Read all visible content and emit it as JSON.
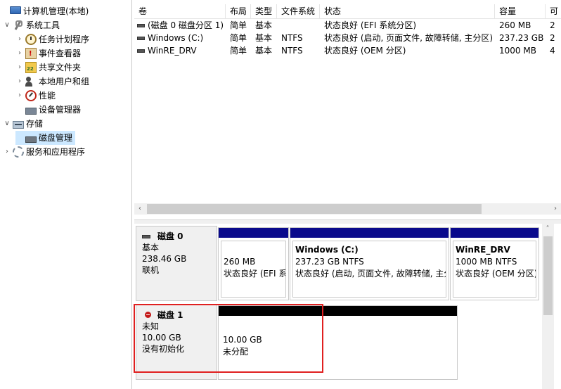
{
  "tree": {
    "items": [
      {
        "name": "tree-root",
        "label": "计算机管理(本地)",
        "icon": "computer-icon",
        "caret": "",
        "level": 0
      },
      {
        "name": "tree-system-tools",
        "label": "系统工具",
        "icon": "tools-icon",
        "caret": "∨",
        "level": 1
      },
      {
        "name": "tree-task-scheduler",
        "label": "任务计划程序",
        "icon": "clock-icon",
        "caret": "›",
        "level": 2
      },
      {
        "name": "tree-event-viewer",
        "label": "事件查看器",
        "icon": "event-viewer-icon",
        "caret": "›",
        "level": 2
      },
      {
        "name": "tree-shared-folders",
        "label": "共享文件夹",
        "icon": "shared-folder-icon",
        "caret": "›",
        "level": 2
      },
      {
        "name": "tree-local-users",
        "label": "本地用户和组",
        "icon": "users-icon",
        "caret": "›",
        "level": 2
      },
      {
        "name": "tree-performance",
        "label": "性能",
        "icon": "performance-icon",
        "caret": "›",
        "level": 2
      },
      {
        "name": "tree-device-manager",
        "label": "设备管理器",
        "icon": "device-manager-icon",
        "caret": "",
        "level": 2
      },
      {
        "name": "tree-storage",
        "label": "存储",
        "icon": "storage-icon",
        "caret": "∨",
        "level": 1
      },
      {
        "name": "tree-disk-management",
        "label": "磁盘管理",
        "icon": "disk-management-icon",
        "caret": "",
        "level": 2,
        "selected": true
      },
      {
        "name": "tree-services",
        "label": "服务和应用程序",
        "icon": "services-icon",
        "caret": "›",
        "level": 1
      }
    ]
  },
  "volumes": {
    "columns": [
      "卷",
      "布局",
      "类型",
      "文件系统",
      "状态",
      "容量",
      "可"
    ],
    "rows": [
      [
        "(磁盘 0 磁盘分区 1)",
        "简单",
        "基本",
        "",
        "状态良好 (EFI 系统分区)",
        "260 MB",
        "2"
      ],
      [
        "Windows (C:)",
        "简单",
        "基本",
        "NTFS",
        "状态良好 (启动, 页面文件, 故障转储, 主分区)",
        "237.23 GB",
        "2"
      ],
      [
        "WinRE_DRV",
        "简单",
        "基本",
        "NTFS",
        "状态良好 (OEM 分区)",
        "1000 MB",
        "4"
      ]
    ],
    "hscroll_left": "‹",
    "hscroll_right": "›"
  },
  "disks": [
    {
      "name": "磁盘 0",
      "type": "基本",
      "size": "238.46 GB",
      "status": "联机",
      "partitions": [
        {
          "name": "",
          "size": "260 MB",
          "status": "状态良好 (EFI 系统分区)",
          "bar_color": "#0a0a8c"
        },
        {
          "name": "Windows  (C:)",
          "size": "237.23 GB NTFS",
          "status": "状态良好 (启动, 页面文件, 故障转储, 主分区)",
          "bar_color": "#0a0a8c"
        },
        {
          "name": "WinRE_DRV",
          "size": "1000 MB NTFS",
          "status": "状态良好 (OEM 分区)",
          "bar_color": "#0a0a8c"
        }
      ]
    },
    {
      "name": "磁盘 1",
      "type": "未知",
      "size": "10.00 GB",
      "status": "没有初始化",
      "partitions": [
        {
          "name": "",
          "size": "10.00 GB",
          "status": "未分配",
          "bar_color": "#000000"
        }
      ]
    }
  ],
  "vscroll_up": "˄",
  "colors": {
    "primary_bar": "#0a0a8c",
    "unallocated_bar": "#000000",
    "selection": "#cce8ff",
    "highlight": "#e02020"
  }
}
